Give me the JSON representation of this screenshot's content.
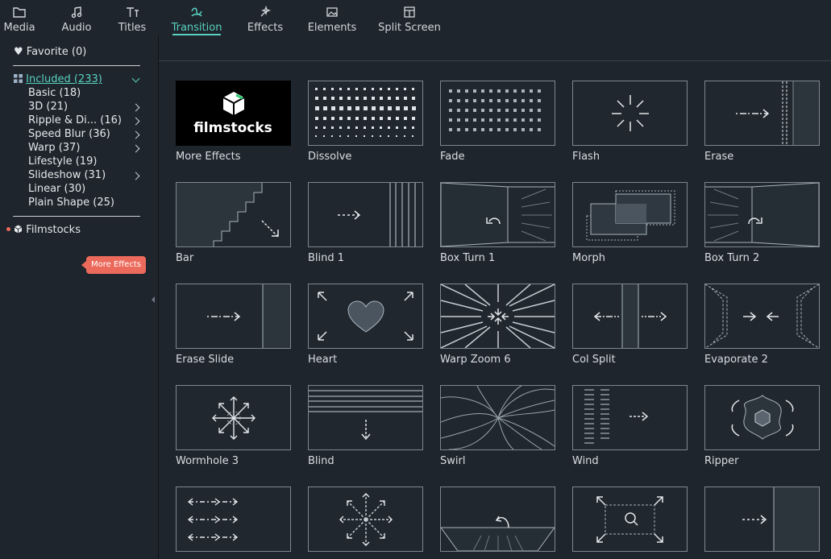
{
  "tabs": [
    {
      "label": "Media",
      "icon": "folder-icon"
    },
    {
      "label": "Audio",
      "icon": "music-note-icon"
    },
    {
      "label": "Titles",
      "icon": "text-icon"
    },
    {
      "label": "Transition",
      "icon": "transition-icon",
      "active": true
    },
    {
      "label": "Effects",
      "icon": "effects-icon"
    },
    {
      "label": "Elements",
      "icon": "image-icon"
    },
    {
      "label": "Split Screen",
      "icon": "split-screen-icon"
    }
  ],
  "sidebar": {
    "favorite": "Favorite (0)",
    "included": "Included (233)",
    "items": [
      {
        "label": "Basic (18)"
      },
      {
        "label": "3D (21)"
      },
      {
        "label": "Ripple & Di... (16)"
      },
      {
        "label": "Speed Blur (36)"
      },
      {
        "label": "Warp (37)"
      },
      {
        "label": "Lifestyle (19)"
      },
      {
        "label": "Slideshow (31)"
      },
      {
        "label": "Linear (30)"
      },
      {
        "label": "Plain Shape (25)"
      }
    ],
    "filmstocks": "Filmstocks",
    "badge": "More Effects"
  },
  "grid": {
    "tiles": [
      {
        "label": "More Effects",
        "logo": "filmstocks"
      },
      {
        "label": "Dissolve"
      },
      {
        "label": "Fade"
      },
      {
        "label": "Flash"
      },
      {
        "label": "Erase"
      },
      {
        "label": "Bar"
      },
      {
        "label": "Blind 1"
      },
      {
        "label": "Box Turn 1"
      },
      {
        "label": "Morph"
      },
      {
        "label": "Box Turn 2"
      },
      {
        "label": "Erase Slide"
      },
      {
        "label": "Heart"
      },
      {
        "label": "Warp Zoom 6"
      },
      {
        "label": "Col Split"
      },
      {
        "label": "Evaporate 2"
      },
      {
        "label": "Wormhole 3"
      },
      {
        "label": "Blind"
      },
      {
        "label": "Swirl"
      },
      {
        "label": "Wind"
      },
      {
        "label": "Ripper"
      },
      {
        "label": ""
      },
      {
        "label": ""
      },
      {
        "label": ""
      },
      {
        "label": ""
      },
      {
        "label": ""
      }
    ]
  },
  "colors": {
    "accent": "#58d1c1",
    "badge": "#ec6a5c",
    "background": "#1f252c",
    "tile_border": "#7d8791"
  }
}
